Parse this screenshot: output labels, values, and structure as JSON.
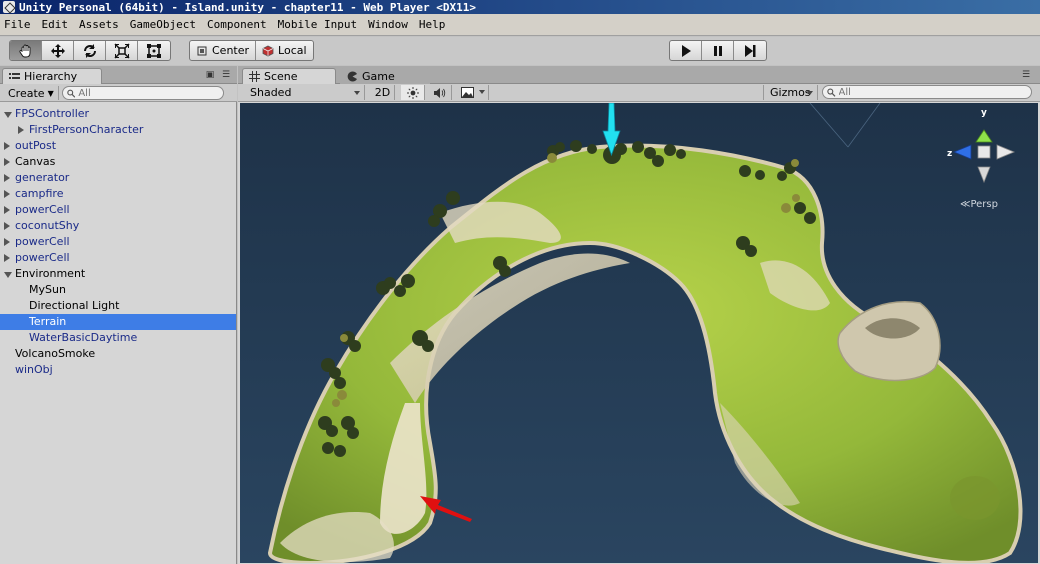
{
  "window": {
    "title": "Unity Personal (64bit) - Island.unity - chapter11 - Web Player <DX11>"
  },
  "menu": [
    "File",
    "Edit",
    "Assets",
    "GameObject",
    "Component",
    "Mobile Input",
    "Window",
    "Help"
  ],
  "toolbar": {
    "pivot_label": "Center",
    "space_label": "Local"
  },
  "hierarchy": {
    "tab_label": "Hierarchy",
    "create_label": "Create",
    "search_placeholder": "All",
    "items": [
      {
        "label": "FPSController"
      },
      {
        "label": "FirstPersonCharacter"
      },
      {
        "label": "outPost"
      },
      {
        "label": "Canvas"
      },
      {
        "label": "generator"
      },
      {
        "label": "campfire"
      },
      {
        "label": "powerCell"
      },
      {
        "label": "coconutShy"
      },
      {
        "label": "powerCell"
      },
      {
        "label": "powerCell"
      },
      {
        "label": "Environment"
      },
      {
        "label": "MySun"
      },
      {
        "label": "Directional Light"
      },
      {
        "label": "Terrain"
      },
      {
        "label": "WaterBasicDaytime"
      },
      {
        "label": "VolcanoSmoke"
      },
      {
        "label": "winObj"
      }
    ]
  },
  "scene": {
    "tab_label": "Scene",
    "game_tab_label": "Game",
    "shading_mode": "Shaded",
    "mode_2d_label": "2D",
    "gizmos_label": "Gizmos",
    "search_placeholder": "All",
    "gizmo_axes": {
      "y": "y",
      "z": "z"
    },
    "projection_label": "Persp"
  },
  "colors": {
    "selection": "#3e7de6",
    "prefab_text": "#1a2a88",
    "water": "#243a52",
    "arrow_cyan": "#22e0f0",
    "arrow_red": "#e01010"
  }
}
